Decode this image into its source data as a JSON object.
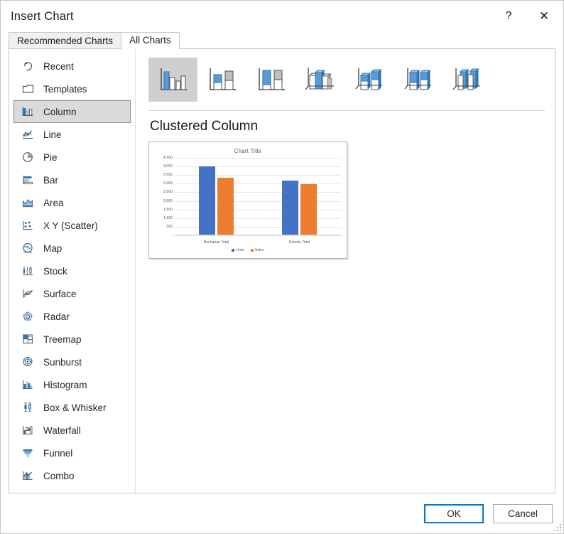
{
  "window": {
    "title": "Insert Chart",
    "help_label": "?",
    "close_label": "✕",
    "help_icon": "question-mark-icon",
    "close_icon": "close-icon"
  },
  "tabs": [
    {
      "label": "Recommended Charts",
      "active": false
    },
    {
      "label": "All Charts",
      "active": true
    }
  ],
  "sidebar": {
    "items": [
      {
        "label": "Recent",
        "icon": "recent-undo-icon",
        "selected": false
      },
      {
        "label": "Templates",
        "icon": "folder-icon",
        "selected": false
      },
      {
        "label": "Column",
        "icon": "column-chart-icon",
        "selected": true
      },
      {
        "label": "Line",
        "icon": "line-chart-icon",
        "selected": false
      },
      {
        "label": "Pie",
        "icon": "pie-chart-icon",
        "selected": false
      },
      {
        "label": "Bar",
        "icon": "bar-chart-icon",
        "selected": false
      },
      {
        "label": "Area",
        "icon": "area-chart-icon",
        "selected": false
      },
      {
        "label": "X Y (Scatter)",
        "icon": "scatter-chart-icon",
        "selected": false
      },
      {
        "label": "Map",
        "icon": "map-globe-icon",
        "selected": false
      },
      {
        "label": "Stock",
        "icon": "stock-chart-icon",
        "selected": false
      },
      {
        "label": "Surface",
        "icon": "surface-chart-icon",
        "selected": false
      },
      {
        "label": "Radar",
        "icon": "radar-chart-icon",
        "selected": false
      },
      {
        "label": "Treemap",
        "icon": "treemap-chart-icon",
        "selected": false
      },
      {
        "label": "Sunburst",
        "icon": "sunburst-chart-icon",
        "selected": false
      },
      {
        "label": "Histogram",
        "icon": "histogram-chart-icon",
        "selected": false
      },
      {
        "label": "Box & Whisker",
        "icon": "box-whisker-icon",
        "selected": false
      },
      {
        "label": "Waterfall",
        "icon": "waterfall-chart-icon",
        "selected": false
      },
      {
        "label": "Funnel",
        "icon": "funnel-chart-icon",
        "selected": false
      },
      {
        "label": "Combo",
        "icon": "combo-chart-icon",
        "selected": false
      }
    ]
  },
  "thumbnails": [
    {
      "name": "clustered-column",
      "selected": true
    },
    {
      "name": "stacked-column",
      "selected": false
    },
    {
      "name": "100-percent-stacked-column",
      "selected": false
    },
    {
      "name": "3d-clustered-column",
      "selected": false
    },
    {
      "name": "3d-stacked-column",
      "selected": false
    },
    {
      "name": "3d-100-percent-stacked-column",
      "selected": false
    },
    {
      "name": "3d-column",
      "selected": false
    }
  ],
  "preview": {
    "heading": "Clustered Column"
  },
  "chart_data": {
    "type": "bar",
    "title": "Chart Title",
    "xlabel": "",
    "ylabel": "",
    "categories": [
      "Buchanan Total",
      "Davolio Total"
    ],
    "series": [
      {
        "name": "Units",
        "color": "#4472C4",
        "values": [
          4000,
          3170
        ]
      },
      {
        "name": "Sales",
        "color": "#ED7D31",
        "values": [
          3350,
          2960
        ]
      }
    ],
    "ylim": [
      0,
      4500
    ],
    "yticks": [
      4500,
      4000,
      3500,
      3000,
      2500,
      2000,
      1500,
      1000,
      500,
      0
    ],
    "ytick_labels": [
      "4,500",
      "4,000",
      "3,500",
      "3,000",
      "2,500",
      "2,000",
      "1,500",
      "1,000",
      "500",
      "-"
    ],
    "grid": true,
    "legend_position": "bottom"
  },
  "footer": {
    "ok_label": "OK",
    "cancel_label": "Cancel"
  },
  "colors": {
    "series_blue": "#4472C4",
    "series_orange": "#ED7D31",
    "focus_blue": "#0078D7",
    "selection_gray": "#DADADA",
    "icon_blue": "#2E75B6",
    "icon_gray": "#595959"
  }
}
